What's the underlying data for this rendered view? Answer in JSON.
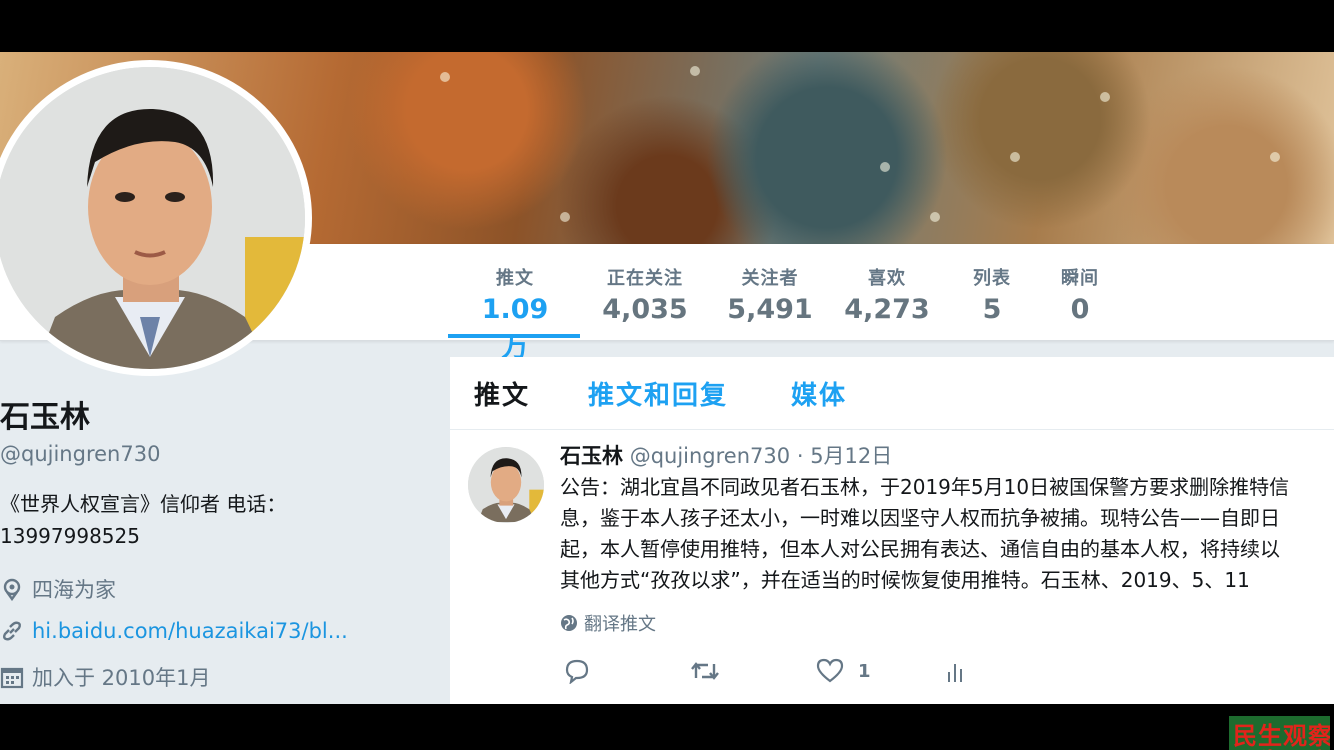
{
  "profile": {
    "name": "石玉林",
    "handle": "@qujingren730",
    "bio": "《世界人权宣言》信仰者 电话：13997998525",
    "location": "四海为家",
    "url": "hi.baidu.com/huazaikai73/bl...",
    "joined": "加入于 2010年1月"
  },
  "stats": [
    {
      "label": "推文",
      "value": "1.09万"
    },
    {
      "label": "正在关注",
      "value": "4,035"
    },
    {
      "label": "关注者",
      "value": "5,491"
    },
    {
      "label": "喜欢",
      "value": "4,273"
    },
    {
      "label": "列表",
      "value": "5"
    },
    {
      "label": "瞬间",
      "value": "0"
    }
  ],
  "timeline_tabs": [
    {
      "label": "推文"
    },
    {
      "label": "推文和回复"
    },
    {
      "label": "媒体"
    }
  ],
  "tweet": {
    "name": "石玉林",
    "handle": "@qujingren730",
    "separator": "·",
    "date": "5月12日",
    "lines": [
      "公告：湖北宜昌不同政见者石玉林，于2019年5月10日被国保警方要求删除推特信",
      "息，鉴于本人孩子还太小，一时难以因坚守人权而抗争被捕。现特公告——自即日",
      "起，本人暂停使用推特，但本人对公民拥有表达、通信自由的基本人权，将持续以",
      "其他方式“孜孜以求”，并在适当的时候恢复使用推特。石玉林、2019、5、11"
    ],
    "translate_label": "翻译推文",
    "like_count": "1"
  },
  "icons": {
    "location": "location-pin-icon",
    "link": "link-icon",
    "calendar": "calendar-icon",
    "globe": "globe-icon",
    "reply": "reply-icon",
    "retweet": "retweet-icon",
    "like": "heart-icon",
    "analytics": "analytics-icon"
  },
  "colors": {
    "accent": "#1da1f2",
    "text_secondary": "#657786",
    "page_bg": "#e6ecf0"
  },
  "watermark": {
    "text": "民生观察",
    "text_cut": "民生观察"
  }
}
